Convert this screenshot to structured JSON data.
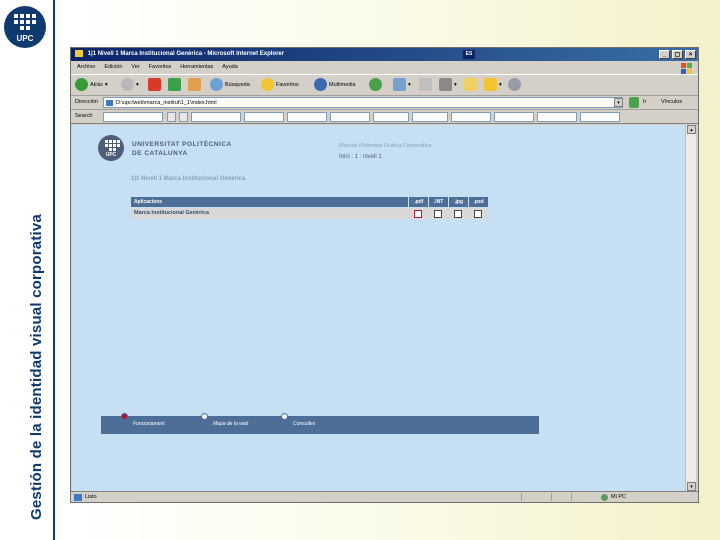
{
  "slide": {
    "vertical_title": "Gestión de la identidad visual corporativa",
    "logo_text": "UPC"
  },
  "browser": {
    "title": "1|1 Nivell 1 Marca Institucional Genèrica - Microsoft Internet Explorer",
    "menu": [
      "Archivo",
      "Edición",
      "Ver",
      "Favoritos",
      "Herramientas",
      "Ayuda"
    ],
    "toolbar": {
      "back": "Atrás",
      "search": "Búsqueda",
      "favorites": "Favoritos",
      "multimedia": "Multimedia"
    },
    "address_label": "Dirección",
    "address": "D:\\upc\\web\\marca_institut\\1_1\\index.html",
    "go_label": "Ir",
    "links_label": "Vínculos",
    "search_label": "Search",
    "search_buttons": [
      "",
      "",
      "",
      "",
      "",
      "",
      "",
      "",
      "",
      "",
      "",
      "",
      "",
      ""
    ],
    "status": "Listo",
    "zone": "Mi PC"
  },
  "page": {
    "logo_text": "UPC",
    "university_name_line1": "UNIVERSITAT POLITÈCNICA",
    "university_name_line2": "DE CATALUNYA",
    "manual_title": "Manual d'Identitat Gràfica Corporativa",
    "breadcrumb": "Inici : 1 : nivell 1",
    "section_title": "1|1 Nivell 1 Marca Institucional Genèrica",
    "table": {
      "header": "Aplicacions",
      "formats": [
        ".pdf",
        ".INT",
        ".jpg",
        ".psd"
      ],
      "rows": [
        {
          "label": "Marca Institucional Genèrica"
        }
      ]
    },
    "nav": [
      "Funcionament",
      "Mapa de la web",
      "Consultes"
    ]
  }
}
